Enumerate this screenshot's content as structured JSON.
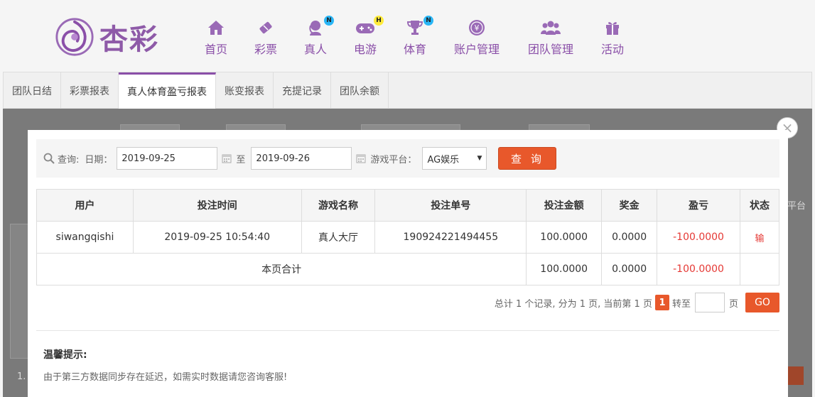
{
  "brand": {
    "name": "杏彩",
    "color": "#8a4fa8"
  },
  "nav": [
    {
      "label": "首页",
      "icon": "home-icon"
    },
    {
      "label": "彩票",
      "icon": "lottery-ticket-icon"
    },
    {
      "label": "真人",
      "icon": "live-dealer-icon",
      "badge": "N"
    },
    {
      "label": "电游",
      "icon": "gamepad-icon",
      "badge": "H"
    },
    {
      "label": "体育",
      "icon": "trophy-icon",
      "badge": "N"
    },
    {
      "label": "账户管理",
      "icon": "yen-coin-icon"
    },
    {
      "label": "团队管理",
      "icon": "team-icon"
    },
    {
      "label": "活动",
      "icon": "gift-icon"
    }
  ],
  "tabs": [
    {
      "label": "团队日结"
    },
    {
      "label": "彩票报表"
    },
    {
      "label": "真人体育盈亏报表",
      "active": true
    },
    {
      "label": "账变报表"
    },
    {
      "label": "充提记录"
    },
    {
      "label": "团队余额"
    }
  ],
  "background": {
    "right_label": "平台",
    "bottom_left": "1."
  },
  "search": {
    "query_label": "查询:",
    "date_label": "日期：",
    "start_date": "2019-09-25",
    "to_label": "至",
    "end_date": "2019-09-26",
    "platform_label": "游戏平台：",
    "platform_value": "AG娱乐",
    "query_button": "查 询"
  },
  "table": {
    "headers": [
      "用户",
      "投注时间",
      "游戏名称",
      "投注单号",
      "投注金额",
      "奖金",
      "盈亏",
      "状态"
    ],
    "rows": [
      {
        "user": "siwangqishi",
        "time": "2019-09-25 10:54:40",
        "game": "真人大厅",
        "bet_no": "190924221494455",
        "amount": "100.0000",
        "bonus": "0.0000",
        "profit": "-100.0000",
        "status": "输"
      }
    ],
    "total": {
      "label": "本页合计",
      "amount": "100.0000",
      "bonus": "0.0000",
      "profit": "-100.0000"
    }
  },
  "pager": {
    "summary": "总计 1 个记录, 分为 1 页, 当前第 1 页",
    "current": "1",
    "goto_label": "转至",
    "page_unit": "页",
    "go_button": "GO"
  },
  "tip": {
    "title": "温馨提示:",
    "text": "由于第三方数据同步存在延迟，如需实时数据请您咨询客服!"
  },
  "colors": {
    "accent": "#e8582b",
    "loss": "#e53935"
  }
}
